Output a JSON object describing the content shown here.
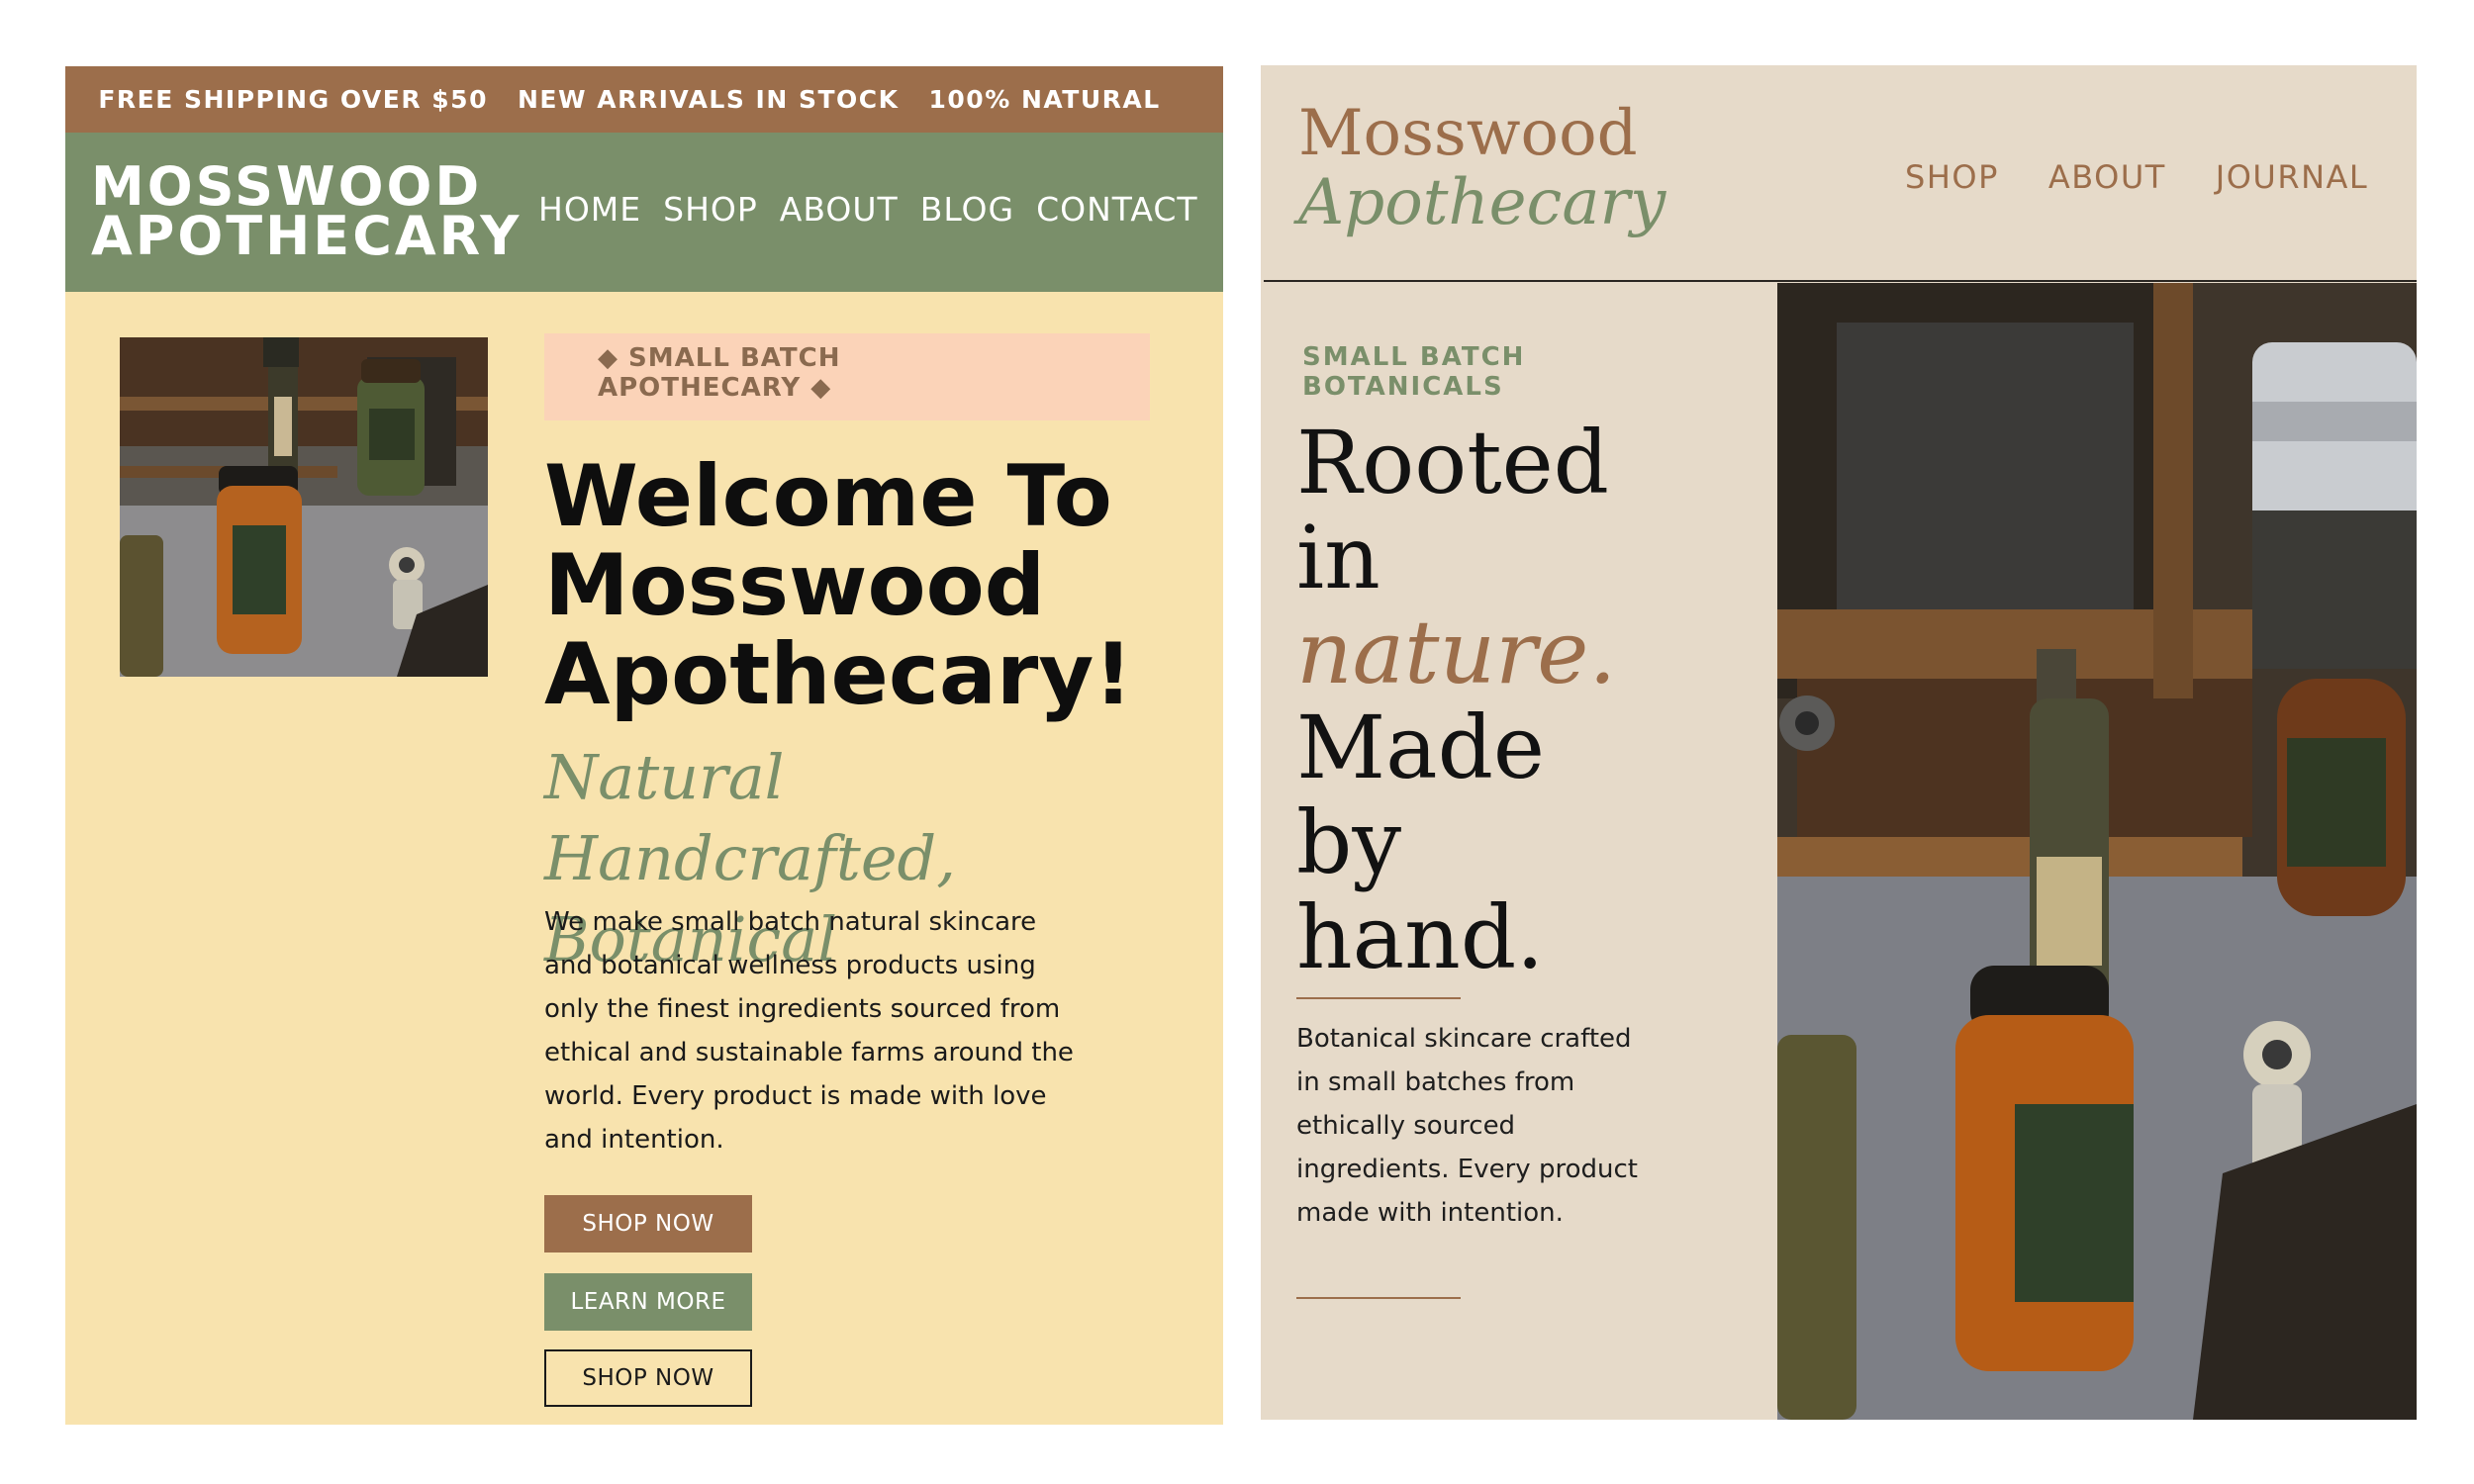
{
  "left_site": {
    "announcement": [
      "FREE SHIPPING OVER $50",
      "NEW ARRIVALS IN STOCK",
      "100% NATURAL"
    ],
    "logo_line1": "MOSSWOOD",
    "logo_line2": "APOTHECARY",
    "nav": [
      "HOME",
      "SHOP",
      "ABOUT",
      "BLOG",
      "CONTACT"
    ],
    "tag_line1": "◆ SMALL BATCH",
    "tag_line2": "APOTHECARY ◆",
    "headline": [
      "Welcome To",
      "Mosswood",
      "Apothecary!"
    ],
    "subheadline": [
      "Natural Handcrafted,",
      "Botanical"
    ],
    "body": [
      "We make small batch natural skincare",
      "and botanical wellness products using",
      "only the finest ingredients sourced from",
      "ethical and sustainable farms around the",
      "world. Every product is made with love",
      "and intention."
    ],
    "buttons": [
      "SHOP NOW",
      "LEARN MORE",
      "SHOP NOW"
    ]
  },
  "right_site": {
    "logo_line1": "Mosswood",
    "logo_line2": "Apothecary",
    "nav": [
      "SHOP",
      "ABOUT",
      "JOURNAL"
    ],
    "tag_line1": "SMALL BATCH",
    "tag_line2": "BOTANICALS",
    "headline": [
      "Rooted",
      "in",
      "nature.",
      "Made",
      "by",
      "hand."
    ],
    "body": [
      "Botanical skincare crafted",
      "in small batches from",
      "ethically sourced",
      "ingredients. Every product",
      "made with intention."
    ]
  },
  "colors": {
    "brown": "#9c6e4b",
    "sage": "#7a8f6a",
    "cream": "#f8e3ae",
    "peach": "#fbd3b8",
    "beige": "#e6dac9"
  }
}
